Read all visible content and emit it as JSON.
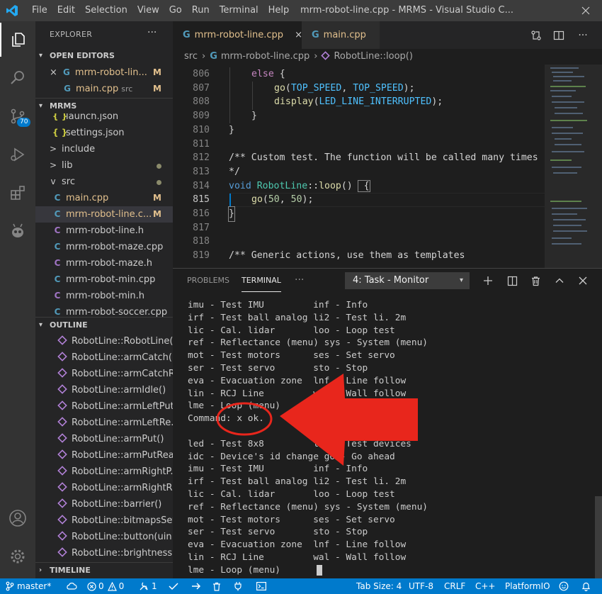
{
  "titlebar": {
    "menu": [
      "File",
      "Edit",
      "Selection",
      "View",
      "Go",
      "Run",
      "Terminal",
      "Help"
    ],
    "window_title": "mrm-robot-line.cpp - MRMS - Visual Studio C..."
  },
  "activitybar": {
    "items": [
      "explorer-icon",
      "search-icon",
      "source-control-icon",
      "run-debug-icon",
      "extensions-icon",
      "alien-icon",
      "account-icon",
      "settings-gear-icon"
    ],
    "scm_badge": "70"
  },
  "sidebar": {
    "title": "EXPLORER",
    "more": "···",
    "open_editors": {
      "header": "OPEN EDITORS",
      "items": [
        {
          "icon": "G",
          "name": "mrm-robot-lin...",
          "tag": "M"
        },
        {
          "icon": "G",
          "name": "main.cpp",
          "sub": "src",
          "tag": "M"
        }
      ]
    },
    "project": {
      "header": "MRMS",
      "items": [
        {
          "icon": "{ }",
          "name": "launch.json"
        },
        {
          "icon": "{ }",
          "name": "settings.json"
        },
        {
          "icon": ">",
          "name": "include"
        },
        {
          "icon": ">",
          "name": "lib"
        },
        {
          "icon": "v",
          "name": "src"
        },
        {
          "icon": "C",
          "name": "main.cpp",
          "tag": "M"
        },
        {
          "icon": "C",
          "name": "mrm-robot-line.c...",
          "tag": "M"
        },
        {
          "icon": "C",
          "name": "mrm-robot-line.h"
        },
        {
          "icon": "C",
          "name": "mrm-robot-maze.cpp"
        },
        {
          "icon": "C",
          "name": "mrm-robot-maze.h"
        },
        {
          "icon": "C",
          "name": "mrm-robot-min.cpp"
        },
        {
          "icon": "C",
          "name": "mrm-robot-min.h"
        },
        {
          "icon": "C",
          "name": "mrm-robot-soccer.cpp"
        }
      ]
    },
    "outline": {
      "header": "OUTLINE",
      "items": [
        "RobotLine::RobotLine(...",
        "RobotLine::armCatch()",
        "RobotLine::armCatchR...",
        "RobotLine::armIdle()",
        "RobotLine::armLeftPut()",
        "RobotLine::armLeftRe...",
        "RobotLine::armPut()",
        "RobotLine::armPutRea...",
        "RobotLine::armRightP...",
        "RobotLine::armRightR...",
        "RobotLine::barrier()",
        "RobotLine::bitmapsSet()",
        "RobotLine::button(uin...",
        "RobotLine::brightness..."
      ]
    },
    "timeline": {
      "header": "TIMELINE"
    }
  },
  "tabs": [
    {
      "icon": "G",
      "label": "mrm-robot-line.cpp",
      "close": "×"
    },
    {
      "icon": "G",
      "label": "main.cpp"
    }
  ],
  "breadcrumb": {
    "folder": "src",
    "file_icon": "G",
    "file": "mrm-robot-line.cpp",
    "symbol": "RobotLine::loop()"
  },
  "editor": {
    "lines": [
      {
        "num": "806"
      },
      {
        "num": "807"
      },
      {
        "num": "808"
      },
      {
        "num": "809"
      },
      {
        "num": "810"
      },
      {
        "num": "811"
      },
      {
        "num": "812"
      },
      {
        "num": "813"
      },
      {
        "num": "814"
      },
      {
        "num": "815"
      },
      {
        "num": "816"
      },
      {
        "num": "817"
      },
      {
        "num": "818"
      },
      {
        "num": "819"
      }
    ],
    "code": {
      "else": "else",
      "brace_open": " {",
      "go": "go",
      "top_speed": "TOP_SPEED",
      "comma": ", ",
      "paren_open": "(",
      "paren_close_semi": ");",
      "display": "display",
      "led_line_interrupted": "LED_LINE_INTERRUPTED",
      "close_brace": "}",
      "comment_custom": "/** Custom test. The function will be called many times",
      "comment_end": "*/",
      "void": "void",
      "robotline": "RobotLine",
      "scope": "::",
      "loop": "loop",
      "empty_parens": "()",
      "go50": "50",
      "comment_generic": "/** Generic actions, use them as templates"
    }
  },
  "panel": {
    "tabs": [
      "PROBLEMS",
      "TERMINAL"
    ],
    "more": "···",
    "terminal_select": "4: Task - Monitor",
    "terminal_lines": [
      "imu - Test IMU         inf - Info",
      "irf - Test ball analog li2 - Test li. 2m",
      "lic - Cal. lidar       loo - Loop test",
      "ref - Reflectance (menu) sys - System (menu)",
      "mot - Test motors      ses - Set servo",
      "ser - Test servo       sto - Stop",
      "eva - Evacuation zone  lnf - Line follow",
      "lin - RCJ Line         wal - Wall follow",
      "lme - Loop (menu)      x - Escape, ok.",
      "Command: x ok.",
      "",
      "led - Test 8x8         lid - Test devices",
      "idc - Device's id change go - Go ahead",
      "imu - Test IMU         inf - Info",
      "irf - Test ball analog li2 - Test li. 2m",
      "lic - Cal. lidar       loo - Loop test",
      "ref - Reflectance (menu) sys - System (menu)",
      "mot - Test motors      ses - Set servo",
      "ser - Test servo       sto - Stop",
      "eva - Evacuation zone  lnf - Line follow",
      "lin - RCJ Line         wal - Wall follow",
      "lme - Loop (menu)"
    ]
  },
  "statusbar": {
    "branch": "master*",
    "errors": "0",
    "warnings": "0",
    "tasks": "1",
    "tab_size": "Tab Size: 4",
    "encoding": "UTF-8",
    "eol": "CRLF",
    "language": "C++",
    "platform": "PlatformIO"
  },
  "colors": {
    "accent": "#007acc",
    "annotation_red": "#e8261c"
  }
}
